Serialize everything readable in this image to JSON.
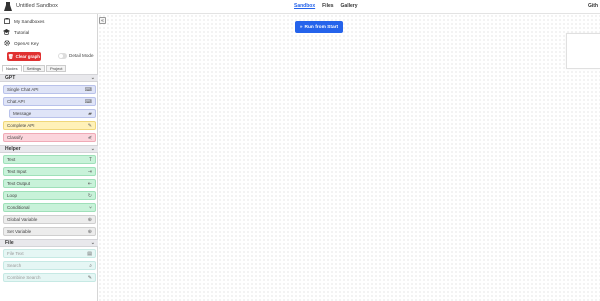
{
  "header": {
    "title": "Untitled Sandbox",
    "nav": [
      {
        "label": "Sandbox",
        "active": true
      },
      {
        "label": "Files",
        "active": false
      },
      {
        "label": "Gallery",
        "active": false
      }
    ],
    "right_label": "Gith"
  },
  "sidebar": {
    "menu": [
      {
        "label": "My Sandboxes",
        "icon": "sandbox-icon"
      },
      {
        "label": "Tutorial",
        "icon": "graduation-cap-icon"
      },
      {
        "label": "OpenAI Key",
        "icon": "gear-icon"
      }
    ],
    "clear_graph_label": "Clear graph",
    "detail_mode_label": "Detail Mode",
    "tabs": [
      {
        "label": "Nodes",
        "active": true
      },
      {
        "label": "Settings",
        "active": false
      },
      {
        "label": "Project",
        "active": false
      }
    ],
    "sections": {
      "gpt": {
        "title": "GPT",
        "items": [
          {
            "label": "Single Chat API"
          },
          {
            "label": "Chat API"
          },
          {
            "label": "Message"
          },
          {
            "label": "Complete API"
          },
          {
            "label": "Classify"
          }
        ]
      },
      "helper": {
        "title": "Helper",
        "items": [
          {
            "label": "Text"
          },
          {
            "label": "Text Input"
          },
          {
            "label": "Text Output"
          },
          {
            "label": "Loop"
          },
          {
            "label": "Conditional"
          },
          {
            "label": "Global Variable"
          },
          {
            "label": "Set Variable"
          }
        ]
      },
      "file": {
        "title": "File",
        "items": [
          {
            "label": "File Text"
          },
          {
            "label": "Search"
          },
          {
            "label": "Combine Search"
          }
        ]
      }
    }
  },
  "canvas": {
    "run_label": "Run from Start"
  },
  "colors": {
    "gpt_blue": "#dfe4f7",
    "gpt_blue_border": "#b9c2ea",
    "complete_yellow": "#fff1b8",
    "classify_pink": "#fbd5dc",
    "helper_green": "#c8f2d9",
    "helper_green_border": "#9fe0b9",
    "grey_node": "#ececec",
    "file_teal": "#e5f6f4",
    "run_blue": "#2563eb",
    "clear_red": "#e03131"
  }
}
